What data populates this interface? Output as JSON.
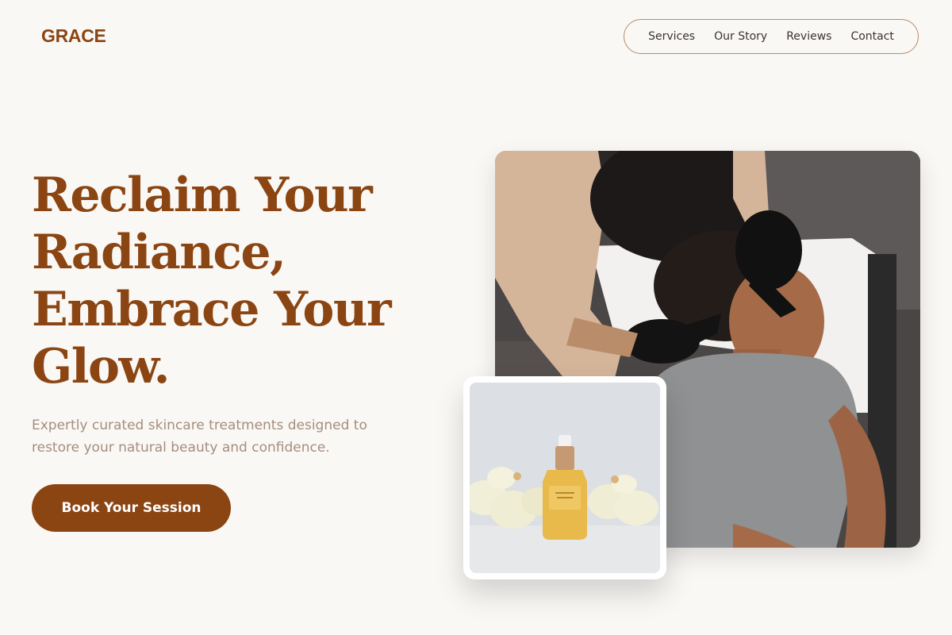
{
  "brand": {
    "logo": "GRACE"
  },
  "nav": {
    "items": [
      {
        "label": "Services"
      },
      {
        "label": "Our Story"
      },
      {
        "label": "Reviews"
      },
      {
        "label": "Contact"
      }
    ]
  },
  "hero": {
    "headline_lines": [
      "Reclaim Your",
      "Radiance,",
      "Embrace Your",
      "Glow."
    ],
    "subtext": "Expertly curated skincare treatments designed to restore your natural beauty and confidence.",
    "cta_label": "Book Your Session"
  },
  "images": {
    "main": "facial-treatment-photo",
    "product": "serum-bottle-photo"
  },
  "colors": {
    "brand": "#8b4513",
    "background": "#faf8f5",
    "subtext": "#a58d7e",
    "nav_border": "#b9896a"
  }
}
